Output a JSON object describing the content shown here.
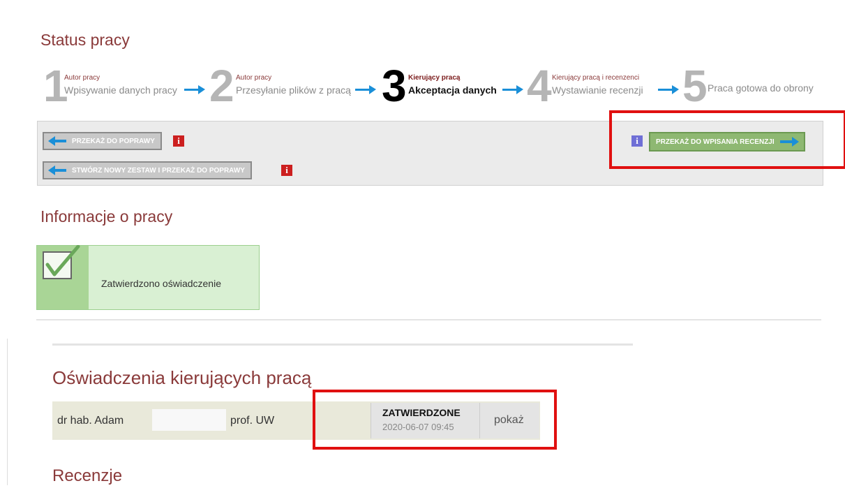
{
  "status_section": {
    "title": "Status pracy",
    "steps": [
      {
        "number": "1",
        "role": "Autor pracy",
        "desc": "Wpisywanie danych pracy",
        "active": false
      },
      {
        "number": "2",
        "role": "Autor pracy",
        "desc": "Przesyłanie plików z pracą",
        "active": false
      },
      {
        "number": "3",
        "role": "Kierujący pracą",
        "desc": "Akceptacja danych",
        "active": true
      },
      {
        "number": "4",
        "role": "Kierujący pracą i recenzenci",
        "desc": "Wystawianie recenzji",
        "active": false
      },
      {
        "number": "5",
        "role": "",
        "desc": "Praca gotowa do obrony",
        "active": false
      }
    ]
  },
  "actions": {
    "return_label": "PRZEKAŻ DO POPRAWY",
    "new_set_label": "STWÓRZ NOWY ZESTAW I PRZEKAŻ DO POPRAWY",
    "forward_label": "PRZEKAŻ DO WPISANIA RECENZJI",
    "info_glyph": "i"
  },
  "info_section": {
    "title": "Informacje o pracy",
    "confirmation_text": "Zatwierdzono oświadczenie"
  },
  "declarations": {
    "title": "Oświadczenia kierujących pracą",
    "rows": [
      {
        "name": "dr hab. Adam",
        "suffix": "prof. UW",
        "status": "ZATWIERDZONE",
        "date": "2020-06-07 09:45",
        "action": "pokaż"
      }
    ]
  },
  "reviews": {
    "title": "Recenzje"
  },
  "colors": {
    "heading": "#8a3a3a",
    "highlight_frame": "#e01010",
    "arrow_blue": "#1a8fd8",
    "green_button": "#8eb872"
  }
}
